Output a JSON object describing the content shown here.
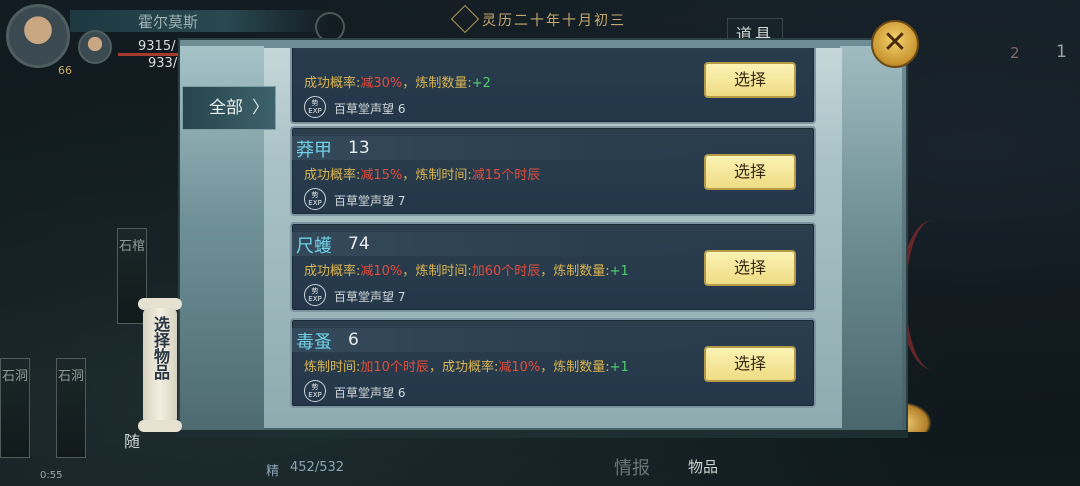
{
  "hud": {
    "player_name": "霍尔莫斯",
    "hp_text": "9315/",
    "mp_text": "933/",
    "level_text": "66"
  },
  "top": {
    "date": "灵历二十年十月初三",
    "daoju_label": "道具",
    "right_num_a": "2",
    "right_num_b": "1"
  },
  "left_tags": {
    "a": "石棺",
    "b": "石洞",
    "c": "石洞"
  },
  "scroll_label": "选择物品",
  "bottom": {
    "sui_label": "随",
    "time": "0:55",
    "jing_label": "精",
    "jing_value": "452/532",
    "qingbao_label": "情报",
    "wupin_label": "物品"
  },
  "panel": {
    "tab_all_label": "全部",
    "close_icon": "close-x-icon"
  },
  "items": [
    {
      "name": "",
      "count": "",
      "effects": [
        {
          "label": "成功概率:",
          "value": "减30%",
          "color": "red"
        },
        {
          "label": "炼制数量:",
          "value": "+2",
          "color": "green"
        }
      ],
      "repute": "百草堂声望 6",
      "select_label": "选择"
    },
    {
      "name": "莽甲",
      "count": "13",
      "effects": [
        {
          "label": "成功概率:",
          "value": "减15%",
          "color": "red"
        },
        {
          "label": "炼制时间:",
          "value": "减15个时辰",
          "color": "red"
        }
      ],
      "repute": "百草堂声望 7",
      "select_label": "选择"
    },
    {
      "name": "尺蠖",
      "count": "74",
      "effects": [
        {
          "label": "成功概率:",
          "value": "减10%",
          "color": "red"
        },
        {
          "label": "炼制时间:",
          "value": "加60个时辰",
          "color": "red"
        },
        {
          "label": "炼制数量:",
          "value": "+1",
          "color": "green"
        }
      ],
      "repute": "百草堂声望 7",
      "select_label": "选择"
    },
    {
      "name": "毒蚤",
      "count": "6",
      "effects": [
        {
          "label": "炼制时间:",
          "value": "加10个时辰",
          "color": "red"
        },
        {
          "label": "成功概率:",
          "value": "减10%",
          "color": "red"
        },
        {
          "label": "炼制数量:",
          "value": "+1",
          "color": "green"
        }
      ],
      "repute": "百草堂声望 6",
      "select_label": "选择"
    }
  ],
  "exp_badge": {
    "top": "势",
    "bottom": "EXP"
  },
  "colors": {
    "effect_label": "#d9b34f",
    "effect_negative": "#e24b3a",
    "effect_positive": "#4ed06a",
    "name_color": "#6fd0e6",
    "select_button": "#f4e49a"
  }
}
